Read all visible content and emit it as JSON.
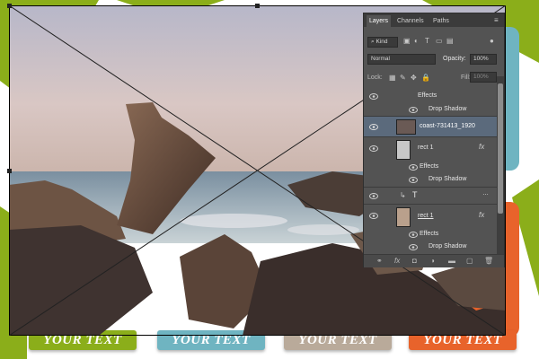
{
  "collage": {
    "label_text": "YOUR TEXT",
    "colors": {
      "green": "#8bae1a",
      "orange": "#e8632b",
      "teal": "#6fb4c1",
      "gray_tan": "#b9aa9a",
      "placeholder": "#a6a6a6"
    }
  },
  "layers_panel": {
    "tabs": [
      "Layers",
      "Channels",
      "Paths"
    ],
    "kind_label": "Kind",
    "blend_mode": "Normal",
    "opacity_label": "Opacity:",
    "opacity_value": "100%",
    "lock_label": "Lock:",
    "fill_label": "Fill:",
    "fill_value": "100%",
    "layers": [
      {
        "name": "Effects",
        "type": "effects"
      },
      {
        "name": "Drop Shadow",
        "type": "effect"
      },
      {
        "name": "coast-731413_1920",
        "type": "image"
      },
      {
        "name": "rect 1",
        "type": "shape",
        "fx": "fx"
      },
      {
        "name": "Effects",
        "type": "effects"
      },
      {
        "name": "Drop Shadow",
        "type": "effect"
      },
      {
        "name": "T",
        "type": "text"
      },
      {
        "name": "rect 1",
        "type": "shape",
        "fx": "fx"
      },
      {
        "name": "Effects",
        "type": "effects"
      },
      {
        "name": "Drop Shadow",
        "type": "effect"
      }
    ],
    "footer_icons": [
      "link-icon",
      "fx-icon",
      "mask-icon",
      "adjustment-icon",
      "folder-icon",
      "new-layer-icon",
      "trash-icon"
    ]
  }
}
